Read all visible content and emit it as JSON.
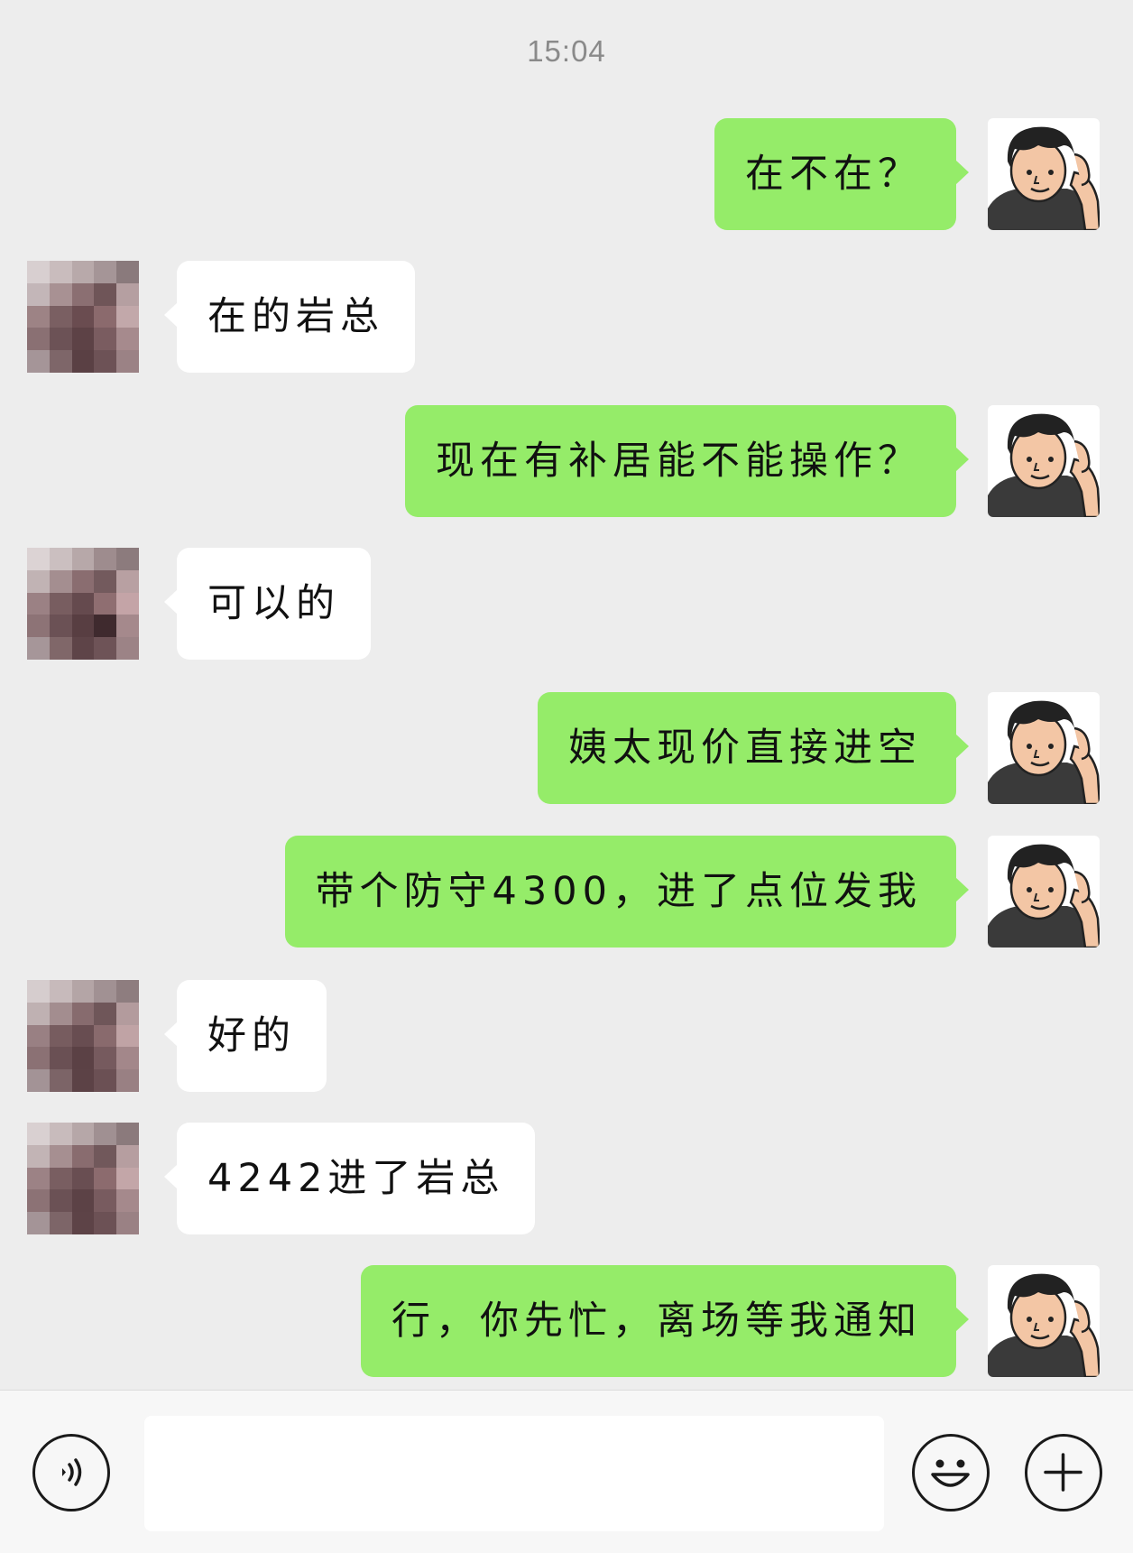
{
  "timestamp": "15:04",
  "messages": [
    {
      "sender": "me",
      "text": "在不在？"
    },
    {
      "sender": "peer",
      "text": "在的岩总"
    },
    {
      "sender": "me",
      "text": "现在有补居能不能操作？"
    },
    {
      "sender": "peer",
      "text": "可以的"
    },
    {
      "sender": "me",
      "text": "姨太现价直接进空"
    },
    {
      "sender": "me",
      "text": "带个防守4300，进了点位发我"
    },
    {
      "sender": "peer",
      "text": "好的"
    },
    {
      "sender": "peer",
      "text": "4242进了岩总"
    },
    {
      "sender": "me",
      "text": "行，你先忙，离场等我通知"
    }
  ],
  "input_bar": {
    "voice_icon": "voice-icon",
    "emoji_icon": "emoji-icon",
    "plus_icon": "plus-icon",
    "text_value": ""
  },
  "colors": {
    "background": "#ededed",
    "my_bubble": "#95ec69",
    "peer_bubble": "#ffffff"
  }
}
